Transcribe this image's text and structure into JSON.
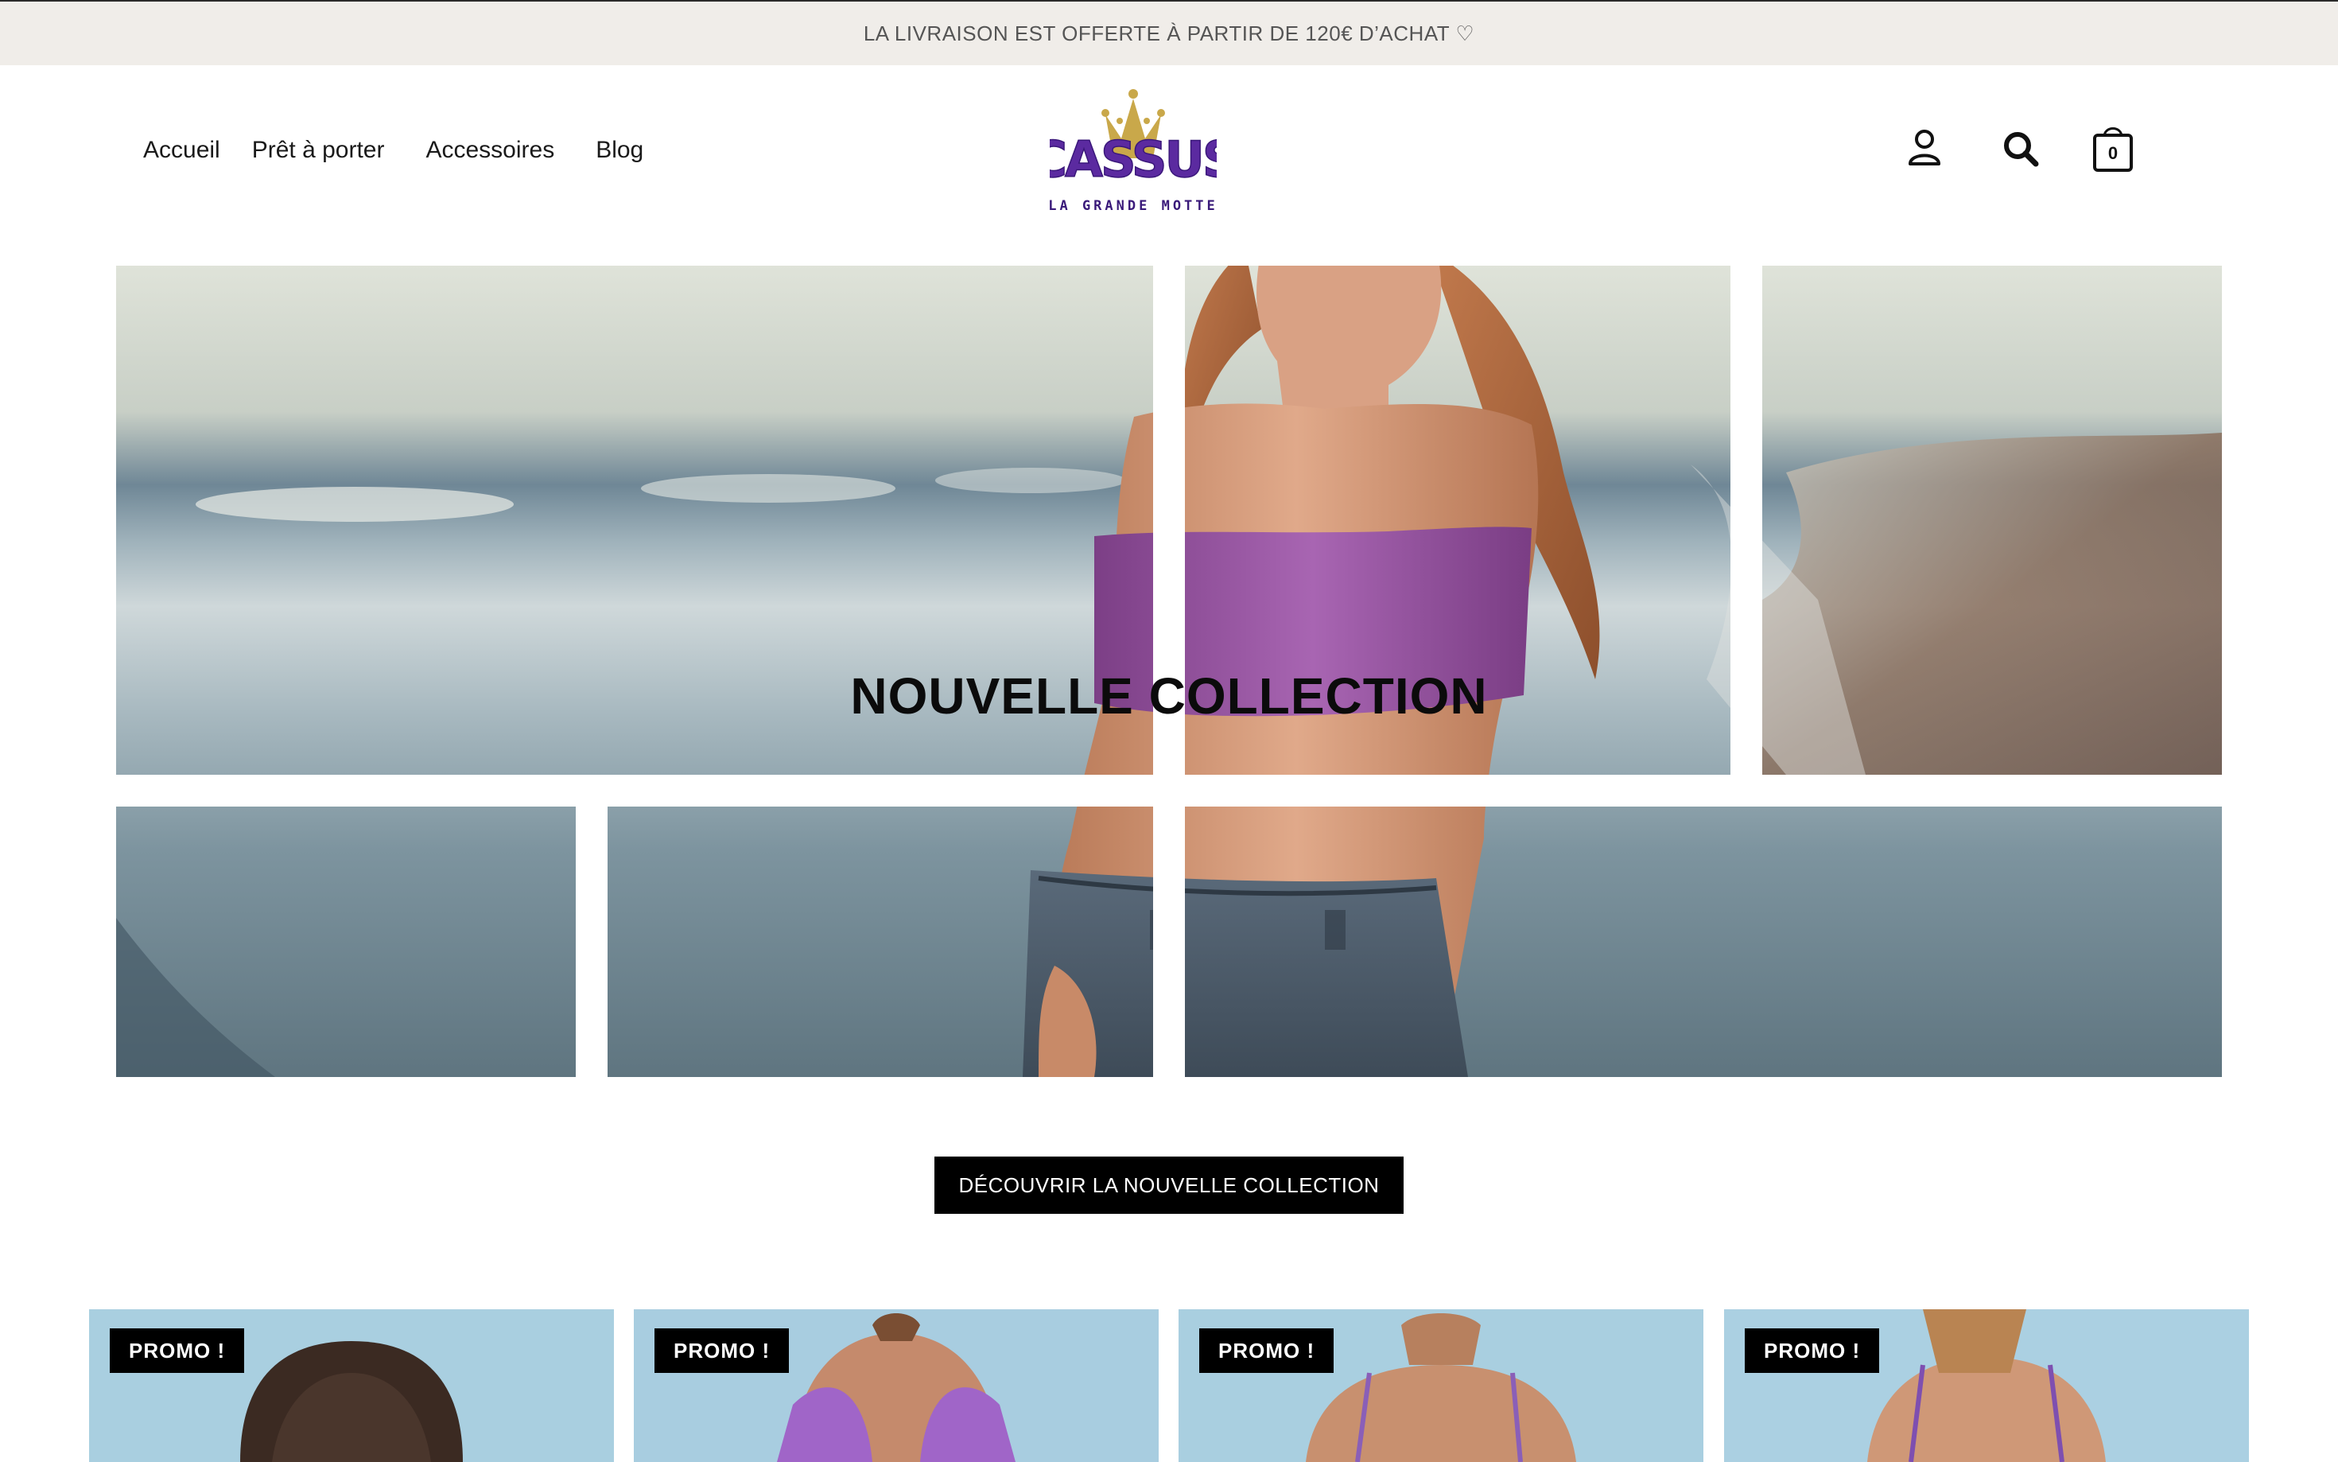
{
  "announcement": {
    "text": "LA LIVRAISON EST OFFERTE À PARTIR DE 120€ D’ACHAT ♡"
  },
  "nav": {
    "items": [
      {
        "label": "Accueil"
      },
      {
        "label": "Prêt à porter"
      },
      {
        "label": "Accessoires"
      },
      {
        "label": "Blog"
      }
    ]
  },
  "logo": {
    "brand": "CASSUS",
    "tagline": "LA GRANDE MOTTE",
    "colors": {
      "purple": "#5b2aa0",
      "gold": "#c9a84a"
    }
  },
  "header_icons": {
    "account": "user-icon",
    "search": "search-icon",
    "cart": "shopping-bag-icon",
    "cart_count": "0"
  },
  "hero": {
    "title": "NOUVELLE COLLECTION",
    "cta_label": "DÉCOUVRIR LA NOUVELLE COLLECTION"
  },
  "products": [
    {
      "badge": "PROMO !"
    },
    {
      "badge": "PROMO !"
    },
    {
      "badge": "PROMO !"
    },
    {
      "badge": "PROMO !"
    }
  ],
  "colors": {
    "announcement_bg": "#f0ede9",
    "button_bg": "#000000",
    "badge_bg": "#000000",
    "top_purple": "#9b5aa8"
  }
}
